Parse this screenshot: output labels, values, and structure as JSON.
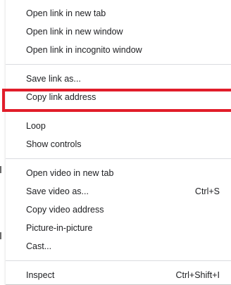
{
  "menu": {
    "group1": [
      {
        "label": "Open link in new tab"
      },
      {
        "label": "Open link in new window"
      },
      {
        "label": "Open link in incognito window"
      }
    ],
    "group2": [
      {
        "label": "Save link as..."
      },
      {
        "label": "Copy link address"
      }
    ],
    "group3": [
      {
        "label": "Loop"
      },
      {
        "label": "Show controls"
      }
    ],
    "group4": [
      {
        "label": "Open video in new tab"
      },
      {
        "label": "Save video as...",
        "shortcut": "Ctrl+S"
      },
      {
        "label": "Copy video address"
      },
      {
        "label": "Picture-in-picture"
      },
      {
        "label": "Cast..."
      }
    ],
    "group5": [
      {
        "label": "Inspect",
        "shortcut": "Ctrl+Shift+I"
      }
    ]
  },
  "highlight_color": "#e11d2a",
  "highlighted_item": "Copy link address"
}
